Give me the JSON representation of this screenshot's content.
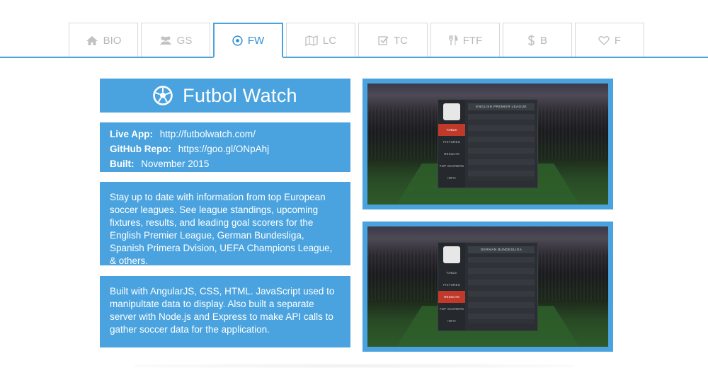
{
  "tabs": [
    {
      "label": "BIO",
      "icon": "home-icon"
    },
    {
      "label": "GS",
      "icon": "users-icon"
    },
    {
      "label": "FW",
      "icon": "soccer-ball-icon",
      "active": true
    },
    {
      "label": "LC",
      "icon": "map-icon"
    },
    {
      "label": "TC",
      "icon": "checkbox-icon"
    },
    {
      "label": "FTF",
      "icon": "cutlery-icon"
    },
    {
      "label": "B",
      "icon": "dollar-icon"
    },
    {
      "label": "F",
      "icon": "heart-icon"
    }
  ],
  "project": {
    "title": "Futbol Watch",
    "title_icon": "soccer-ball-icon",
    "live_app_key": "Live App:",
    "live_app_value": "http://futbolwatch.com/",
    "github_key": "GitHub Repo:",
    "github_value": "https://goo.gl/ONpAhj",
    "built_key": "Built:",
    "built_value": "November 2015",
    "description": "Stay up to date with information from top European soccer leagues. See league standings, upcoming fixtures, results, and leading goal scorers for the English Premier League, German Bundesliga, Spanish Primera Dvision, UEFA Champions League, & others.",
    "tech": "Built with AngularJS, CSS, HTML. JavaScript used to manipultate data to display. Also built a separate server with Node.js and Express to make API calls to gather soccer data for the application."
  },
  "screenshots": [
    {
      "league": "ENGLISH PREMIER LEAGUE",
      "menu": [
        "TABLE",
        "FIXTURES",
        "RESULTS",
        "TOP SCORERS",
        "INFO"
      ],
      "active": "TABLE"
    },
    {
      "league": "GERMAN BUNDESLIGA",
      "menu": [
        "TABLE",
        "FIXTURES",
        "RESULTS",
        "TOP SCORERS",
        "INFO"
      ],
      "active": "RESULTS"
    }
  ],
  "colors": {
    "accent": "#4aa3df",
    "active_tab_text": "#2f8fd1",
    "inactive_tab_text": "#b8b8b8"
  }
}
